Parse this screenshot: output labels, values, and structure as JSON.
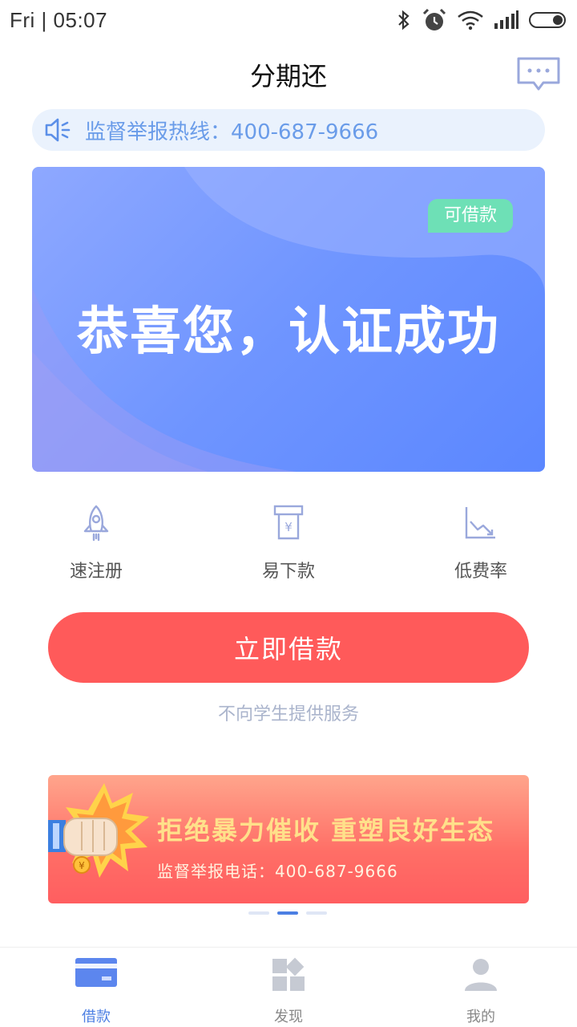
{
  "status_bar": {
    "time": "Fri | 05:07"
  },
  "header": {
    "title": "分期还"
  },
  "notice": {
    "text": "监督举报热线：400-687-9666"
  },
  "banner": {
    "badge": "可借款",
    "title": "恭喜您，认证成功"
  },
  "features": [
    {
      "icon": "rocket-icon",
      "label": "速注册"
    },
    {
      "icon": "atm-cash-icon",
      "label": "易下款"
    },
    {
      "icon": "trend-down-icon",
      "label": "低费率"
    }
  ],
  "cta": {
    "label": "立即借款",
    "note": "不向学生提供服务"
  },
  "promo": {
    "title": "拒绝暴力催收  重塑良好生态",
    "subtitle": "监督举报电话：400-687-9666",
    "coin_symbol": "¥"
  },
  "carousel": {
    "active_index": 1,
    "count": 3
  },
  "tabbar": [
    {
      "icon": "card-icon",
      "label": "借款",
      "active": true
    },
    {
      "icon": "discover-icon",
      "label": "发现",
      "active": false
    },
    {
      "icon": "user-icon",
      "label": "我的",
      "active": false
    }
  ],
  "colors": {
    "accent": "#4c7fe3",
    "cta": "#ff5a5a",
    "badge": "#6ee0b6",
    "notice_text": "#6a9ce9"
  }
}
